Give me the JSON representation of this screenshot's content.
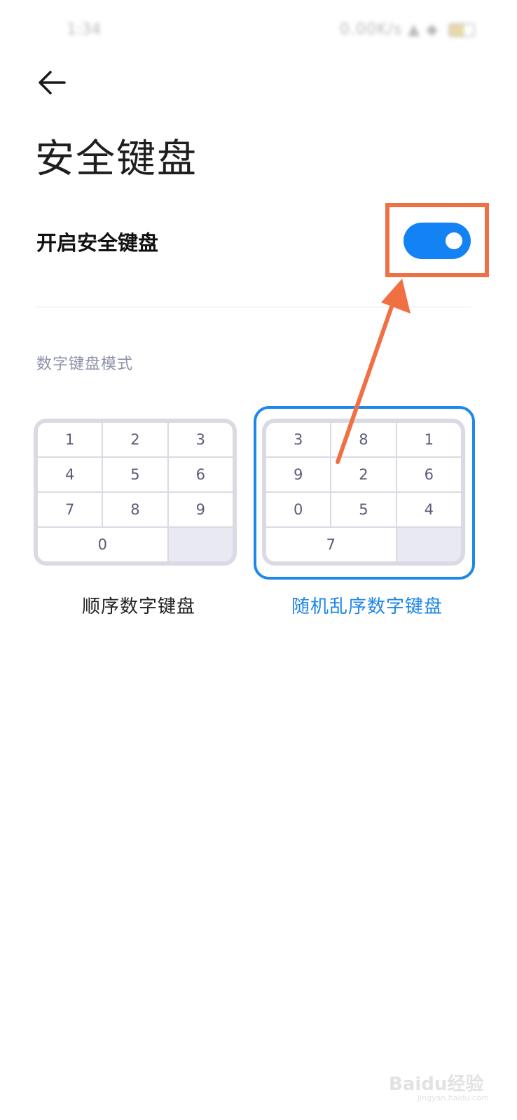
{
  "status_bar": {
    "time": "1:34",
    "indicators": "0.00K/s ▲ ◆"
  },
  "header": {
    "back_icon": "arrow-left-icon",
    "title": "安全键盘"
  },
  "setting": {
    "label": "开启安全键盘",
    "enabled": true
  },
  "section": {
    "title": "数字键盘模式"
  },
  "keypads": {
    "sequential": {
      "label": "顺序数字键盘",
      "keys": [
        "1",
        "2",
        "3",
        "4",
        "5",
        "6",
        "7",
        "8",
        "9",
        "0"
      ],
      "selected": false
    },
    "random": {
      "label": "随机乱序数字键盘",
      "keys": [
        "3",
        "8",
        "1",
        "9",
        "2",
        "6",
        "0",
        "5",
        "4",
        "7"
      ],
      "selected": true
    }
  },
  "colors": {
    "accent": "#1282f5",
    "annotation": "#f07044",
    "selected_label": "#1d86e6"
  },
  "watermark": {
    "text": "Baidu经验",
    "url": "jingyan.baidu.com"
  }
}
